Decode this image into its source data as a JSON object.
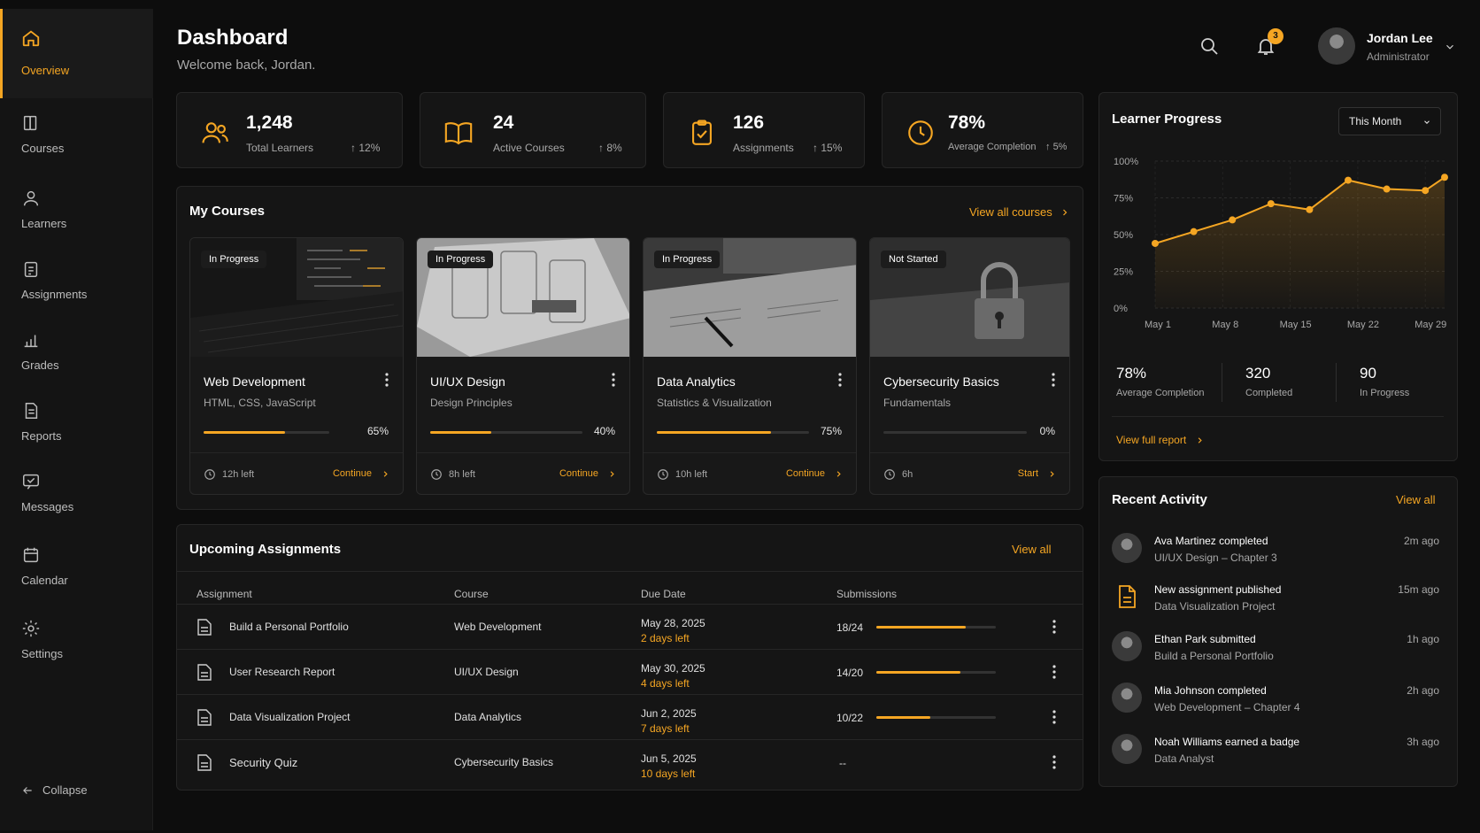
{
  "header": {
    "title": "Dashboard",
    "subtitle": "Welcome back, Jordan.",
    "notification_count": "3"
  },
  "user": {
    "name": "Jordan Lee",
    "role": "Administrator"
  },
  "sidebar": {
    "items": [
      {
        "label": "Overview",
        "icon": "home-icon",
        "active": true
      },
      {
        "label": "Courses",
        "icon": "book-icon"
      },
      {
        "label": "Learners",
        "icon": "user-icon"
      },
      {
        "label": "Assignments",
        "icon": "clipboard-icon"
      },
      {
        "label": "Grades",
        "icon": "bar-chart-icon"
      },
      {
        "label": "Reports",
        "icon": "document-icon"
      },
      {
        "label": "Messages",
        "icon": "message-icon"
      },
      {
        "label": "Calendar",
        "icon": "calendar-icon"
      },
      {
        "label": "Settings",
        "icon": "gear-icon"
      }
    ],
    "collapse_label": "Collapse"
  },
  "stats": [
    {
      "value": "1,248",
      "label": "Total Learners",
      "delta": "12%",
      "icon": "users-icon"
    },
    {
      "value": "24",
      "label": "Active Courses",
      "delta": "8%",
      "icon": "open-book-icon"
    },
    {
      "value": "126",
      "label": "Assignments",
      "delta": "15%",
      "icon": "clipboard-check-icon"
    },
    {
      "value": "78%",
      "label": "Average Completion",
      "delta": "5%",
      "icon": "clock-icon"
    }
  ],
  "my_courses": {
    "title": "My Courses",
    "view_all": "View all courses",
    "items": [
      {
        "status": "In Progress",
        "title": "Web Development",
        "subtitle": "HTML, CSS, JavaScript",
        "progress": 65,
        "progress_label": "65%",
        "time": "12h left",
        "action": "Continue"
      },
      {
        "status": "In Progress",
        "title": "UI/UX Design",
        "subtitle": "Design Principles",
        "progress": 40,
        "progress_label": "40%",
        "time": "8h left",
        "action": "Continue"
      },
      {
        "status": "In Progress",
        "title": "Data Analytics",
        "subtitle": "Statistics & Visualization",
        "progress": 75,
        "progress_label": "75%",
        "time": "10h left",
        "action": "Continue"
      },
      {
        "status": "Not Started",
        "title": "Cybersecurity Basics",
        "subtitle": "Fundamentals",
        "progress": 0,
        "progress_label": "0%",
        "time": "6h",
        "action": "Start"
      }
    ]
  },
  "assignments": {
    "title": "Upcoming Assignments",
    "view_all": "View all",
    "columns": [
      "Assignment",
      "Course",
      "Due Date",
      "Submissions"
    ],
    "rows": [
      {
        "name": "Build a Personal Portfolio",
        "course": "Web Development",
        "due": "May 28, 2025",
        "left": "2 days left",
        "submissions": "18/24",
        "ratio": 0.75
      },
      {
        "name": "User Research Report",
        "course": "UI/UX Design",
        "due": "May 30, 2025",
        "left": "4 days left",
        "submissions": "14/20",
        "ratio": 0.7
      },
      {
        "name": "Data Visualization Project",
        "course": "Data Analytics",
        "due": "Jun 2, 2025",
        "left": "7 days left",
        "submissions": "10/22",
        "ratio": 0.4545
      },
      {
        "name": "Security Quiz",
        "course": "Cybersecurity Basics",
        "due": "Jun 5, 2025",
        "left": "10 days left",
        "submissions": "--",
        "ratio": null
      }
    ]
  },
  "learner_progress": {
    "title": "Learner Progress",
    "period": "This Month",
    "view_report": "View full report",
    "stats": [
      {
        "value": "78%",
        "label": "Average Completion"
      },
      {
        "value": "320",
        "label": "Completed"
      },
      {
        "value": "90",
        "label": "In Progress"
      }
    ]
  },
  "chart_data": {
    "type": "area",
    "x_tick_labels": [
      "May 1",
      "May 8",
      "May 15",
      "May 22",
      "May 29"
    ],
    "y_tick_labels": [
      "100%",
      "75%",
      "50%",
      "25%",
      "0%"
    ],
    "ylim": [
      0,
      100
    ],
    "x": [
      1,
      5,
      9,
      13,
      17,
      21,
      25,
      29,
      31
    ],
    "values": [
      44,
      52,
      60,
      71,
      67,
      87,
      81,
      80,
      89
    ],
    "color": "#f5a623"
  },
  "recent_activity": {
    "title": "Recent Activity",
    "view_all": "View all",
    "items": [
      {
        "title": "Ava Martinez completed",
        "detail": "UI/UX Design – Chapter 3",
        "time": "2m ago",
        "avatar": "avatar-female"
      },
      {
        "title": "New assignment published",
        "detail": "Data Visualization Project",
        "time": "15m ago",
        "avatar": "document-icon"
      },
      {
        "title": "Ethan Park submitted",
        "detail": "Build a Personal Portfolio",
        "time": "1h ago",
        "avatar": "avatar-male"
      },
      {
        "title": "Mia Johnson completed",
        "detail": "Web Development – Chapter 4",
        "time": "2h ago",
        "avatar": "avatar-female"
      },
      {
        "title": "Noah Williams earned a badge",
        "detail": "Data Analyst",
        "time": "3h ago",
        "avatar": "avatar-male"
      }
    ]
  },
  "colors": {
    "accent": "#f5a623",
    "background": "#0d0d0d",
    "panel": "#151515"
  }
}
